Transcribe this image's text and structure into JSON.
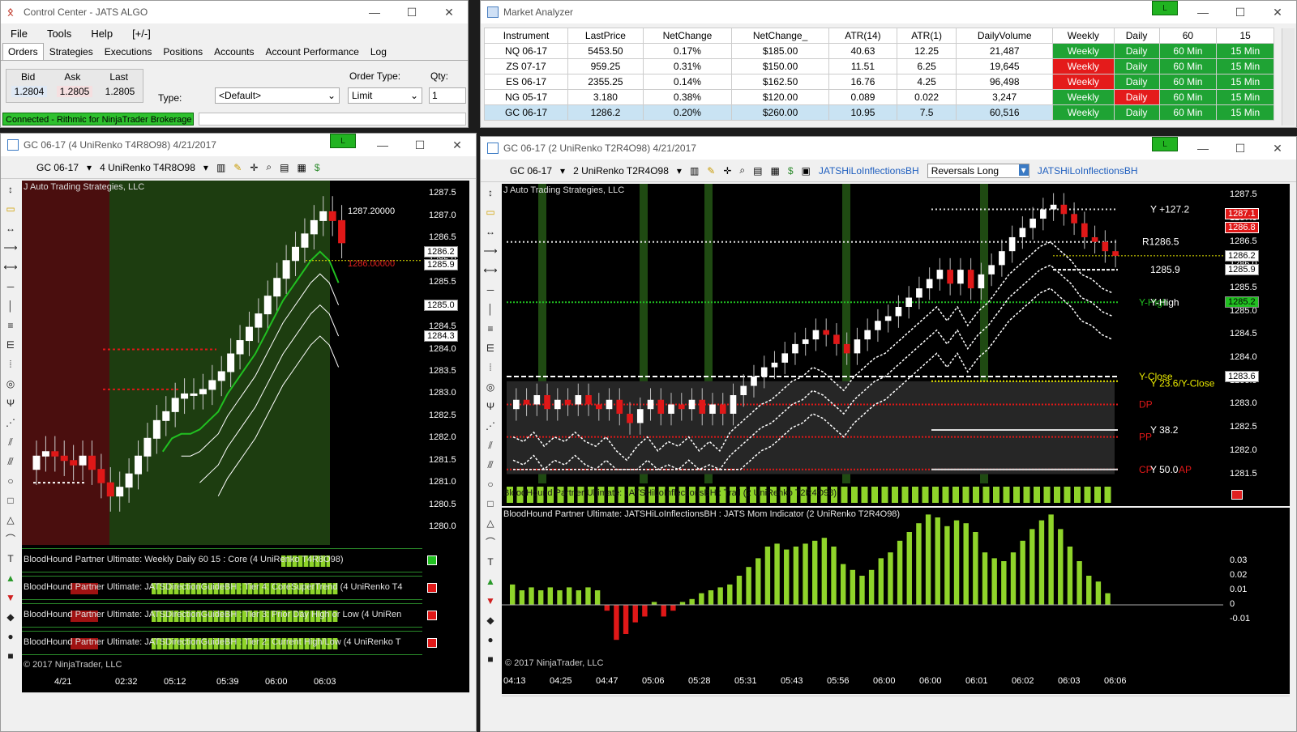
{
  "control_center": {
    "title": "Control Center - JATS ALGO",
    "menu": [
      "File",
      "Tools",
      "Help",
      "[+/-]"
    ],
    "tabs": [
      "Orders",
      "Strategies",
      "Executions",
      "Positions",
      "Accounts",
      "Account Performance",
      "Log"
    ],
    "bid_label": "Bid",
    "ask_label": "Ask",
    "last_label": "Last",
    "bid": "1.2804",
    "ask": "1.2805",
    "last": "1.2805",
    "type_label": "Type:",
    "type_value": "<Default>",
    "order_type_label": "Order Type:",
    "order_type_value": "Limit",
    "qty_label": "Qty:",
    "qty_value": "1",
    "status": "Connected - Rithmic for NinjaTrader Brokerage"
  },
  "market_analyzer": {
    "title": "Market Analyzer",
    "badge": "L",
    "columns": [
      "Instrument",
      "LastPrice",
      "NetChange",
      "NetChange_",
      "ATR(14)",
      "ATR(1)",
      "DailyVolume",
      "Weekly",
      "Daily",
      "60",
      "15"
    ],
    "rows": [
      {
        "instrument": "NQ 06-17",
        "last": "5453.50",
        "netchg": "0.17%",
        "netchg2": "$185.00",
        "atr14": "40.63",
        "atr1": "12.25",
        "vol": "21,487",
        "weekly": "Weekly",
        "weekly_c": "green",
        "daily": "Daily",
        "daily_c": "green",
        "m60": "60 Min",
        "m15": "15 Min"
      },
      {
        "instrument": "ZS 07-17",
        "last": "959.25",
        "netchg": "0.31%",
        "netchg2": "$150.00",
        "atr14": "11.51",
        "atr1": "6.25",
        "vol": "19,645",
        "weekly": "Weekly",
        "weekly_c": "red",
        "daily": "Daily",
        "daily_c": "green",
        "m60": "60 Min",
        "m15": "15 Min"
      },
      {
        "instrument": "ES 06-17",
        "last": "2355.25",
        "netchg": "0.14%",
        "netchg2": "$162.50",
        "atr14": "16.76",
        "atr1": "4.25",
        "vol": "96,498",
        "weekly": "Weekly",
        "weekly_c": "red",
        "daily": "Daily",
        "daily_c": "green",
        "m60": "60 Min",
        "m15": "15 Min"
      },
      {
        "instrument": "NG 05-17",
        "last": "3.180",
        "netchg": "0.38%",
        "netchg2": "$120.00",
        "atr14": "0.089",
        "atr1": "0.022",
        "vol": "3,247",
        "weekly": "Weekly",
        "weekly_c": "green",
        "daily": "Daily",
        "daily_c": "red",
        "m60": "60 Min",
        "m15": "15 Min"
      },
      {
        "instrument": "GC 06-17",
        "last": "1286.2",
        "netchg": "0.20%",
        "netchg2": "$260.00",
        "atr14": "10.95",
        "atr1": "7.5",
        "vol": "60,516",
        "weekly": "Weekly",
        "weekly_c": "green",
        "daily": "Daily",
        "daily_c": "green",
        "m60": "60 Min",
        "m15": "15 Min"
      }
    ]
  },
  "chart_left": {
    "title": "GC 06-17 (4 UniRenko T4R8O98)  4/21/2017",
    "badge": "L",
    "instrument": "GC 06-17",
    "period": "4 UniRenko T4R8O98",
    "watermark": "J Auto Trading Strategies, LLC",
    "price_labels": [
      "1287.5",
      "1287.0",
      "1286.5",
      "1286.0",
      "1285.5",
      "1285.0",
      "1284.5",
      "1284.0",
      "1283.5",
      "1283.0",
      "1282.5",
      "1282.0",
      "1281.5",
      "1281.0",
      "1280.5",
      "1280.0"
    ],
    "marker_top": "1287.20000",
    "marker_red": "1286.00000",
    "tags": [
      "1286.2",
      "1285.9",
      "1285.0",
      "1284.3"
    ],
    "x_labels": [
      "4/21",
      "02:32",
      "05:12",
      "05:39",
      "06:00",
      "06:03"
    ],
    "indicators": [
      "BloodHound Partner Ultimate: Weekly Daily 60 15 : Core (4 UniRenko T4R8O98)",
      "BloodHound Partner Ultimate: JATSDirectionGuideBH : Tier 4: CoreSuperTrend (4 UniRenko T4",
      "BloodHound Partner Ultimate: JATSDirectionGuideBH : Tier 3: Prior Day High or Low (4 UniRen",
      "BloodHound Partner Ultimate: JATSDirectionGuideBH : Tier 2: Current High/Low (4 UniRenko T"
    ],
    "copyright": "© 2017 NinjaTrader, LLC"
  },
  "chart_right": {
    "title": "GC 06-17 (2 UniRenko T2R4O98)  4/21/2017",
    "badge": "L",
    "instrument": "GC 06-17",
    "period": "2 UniRenko T2R4O98",
    "strategy1": "JATSHiLoInflectionsBH",
    "dropdown": "Reversals Long",
    "strategy2": "JATSHiLoInflectionsBH",
    "watermark": "J Auto Trading Strategies, LLC",
    "price_labels": [
      "1287.5",
      "1287.0",
      "1286.5",
      "1286.0",
      "1285.5",
      "1285.0",
      "1284.5",
      "1284.0",
      "1283.5",
      "1283.0",
      "1282.5",
      "1282.0",
      "1281.5"
    ],
    "tags_red": [
      "1287.1",
      "1286.8"
    ],
    "tags": [
      "1286.2",
      "1285.9",
      "1285.2",
      "1283.6"
    ],
    "level_labels": {
      "y127": "Y +127.2",
      "r": "R1286.5",
      "p": "1285.9",
      "yhigh": "Y-High",
      "yhigh2": "Y-High",
      "yclose": "Y-Close",
      "yclose2": "Y 23.6/Y-Close",
      "dp": "DP",
      "pp": "PP",
      "y382": "Y 38.2",
      "cp": "CP",
      "y50": "Y 50.0",
      "ap": "AP"
    },
    "ind1": "BloodHound Partner Ultimate: JATSHiLoInflectionsBH : Trail (2 UniRenko T2R4O98)",
    "ind2": "BloodHound Partner Ultimate: JATSHiLoInflectionsBH : JATS Mom Indicator (2 UniRenko T2R4O98)",
    "mom_labels": [
      "0.03",
      "0.02",
      "0.01",
      "0",
      "-0.01"
    ],
    "x_labels": [
      "04:13",
      "04:25",
      "04:47",
      "05:06",
      "05:28",
      "05:31",
      "05:43",
      "05:56",
      "06:00",
      "06:00",
      "06:01",
      "06:02",
      "06:03",
      "06:06"
    ],
    "copyright": "© 2017 NinjaTrader, LLC"
  },
  "icons": {
    "sidebar": [
      "pointer-icon",
      "pan-icon",
      "arrow-line-icon",
      "ray-icon",
      "extended-line-icon",
      "horizontal-line-icon",
      "vertical-line-icon",
      "fib-retracement-icon",
      "fib-extension-icon",
      "fib-time-icon",
      "fib-circle-icon",
      "andrews-pitchfork-icon",
      "gann-fan-icon",
      "regression-icon",
      "trend-channel-icon",
      "ellipse-icon",
      "rectangle-icon",
      "triangle-icon",
      "arc-icon",
      "text-icon",
      "arrow-up-icon",
      "arrow-down-icon",
      "diamond-icon",
      "dot-icon",
      "square-icon"
    ]
  }
}
